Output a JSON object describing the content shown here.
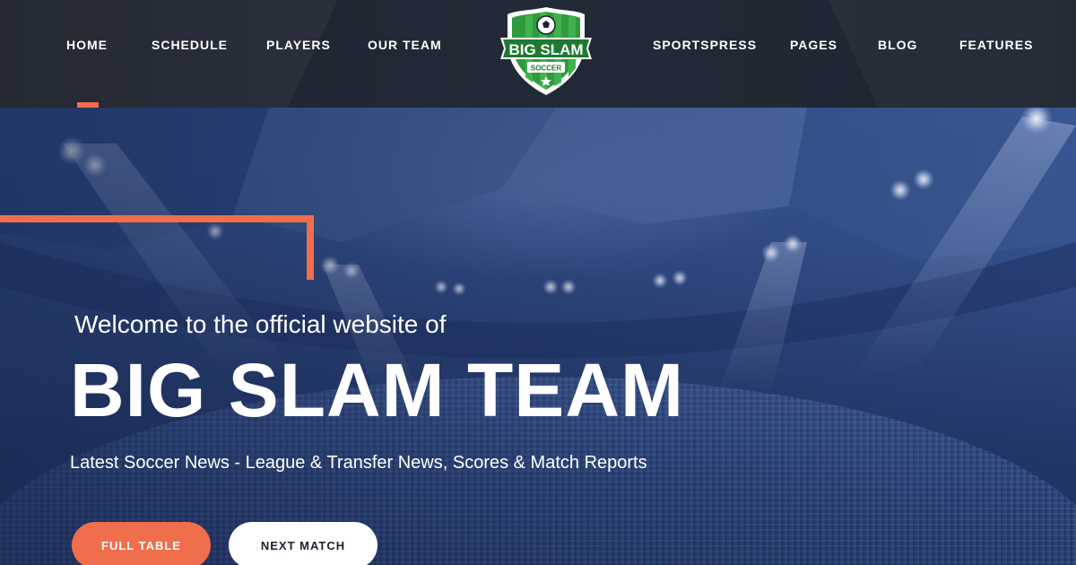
{
  "nav": {
    "left": [
      {
        "label": "HOME"
      },
      {
        "label": "SCHEDULE"
      },
      {
        "label": "PLAYERS"
      },
      {
        "label": "OUR TEAM"
      }
    ],
    "right": [
      {
        "label": "SPORTSPRESS"
      },
      {
        "label": "PAGES"
      },
      {
        "label": "BLOG"
      },
      {
        "label": "FEATURES"
      }
    ]
  },
  "logo": {
    "title": "BIG SLAM",
    "subtitle": "SOCCER"
  },
  "hero": {
    "welcome": "Welcome to the official website of",
    "headline": "BIG SLAM TEAM",
    "tagline": "Latest Soccer News - League & Transfer News, Scores & Match Reports",
    "buttons": {
      "primary": "FULL TABLE",
      "secondary": "NEXT MATCH"
    }
  },
  "colors": {
    "accent": "#ef6e4c",
    "header_bg": "#1f2531",
    "hero_blue": "#2e4a86",
    "logo_green": "#2f9a3e"
  }
}
